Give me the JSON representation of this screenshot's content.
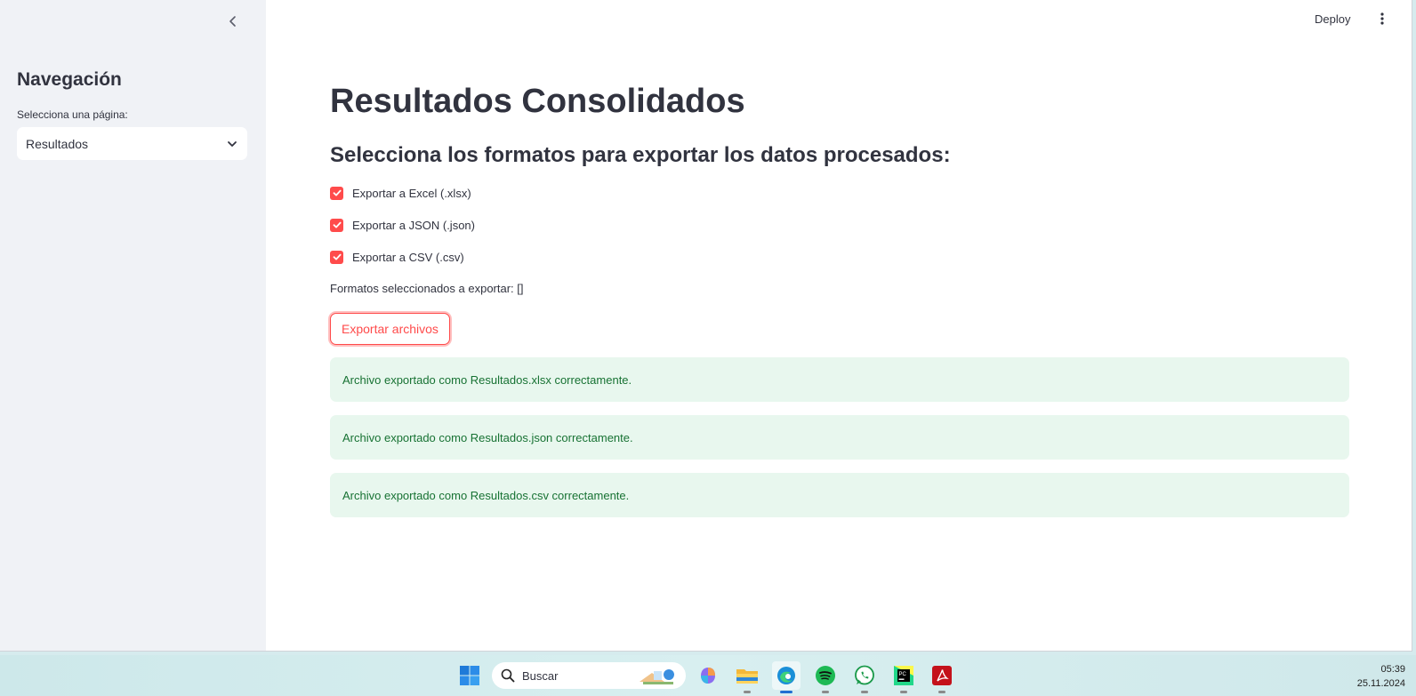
{
  "sidebar": {
    "title": "Navegación",
    "select_label": "Selecciona una página:",
    "select_value": "Resultados"
  },
  "topbar": {
    "deploy_label": "Deploy"
  },
  "main": {
    "title": "Resultados Consolidados",
    "subheader": "Selecciona los formatos para exportar los datos procesados:",
    "checkboxes": [
      {
        "label": "Exportar a Excel (.xlsx)",
        "checked": true
      },
      {
        "label": "Exportar a JSON (.json)",
        "checked": true
      },
      {
        "label": "Exportar a CSV (.csv)",
        "checked": true
      }
    ],
    "selected_formats_text": "Formatos seleccionados a exportar: []",
    "export_button_label": "Exportar archivos",
    "alerts": [
      "Archivo exportado como Resultados.xlsx correctamente.",
      "Archivo exportado como Resultados.json correctamente.",
      "Archivo exportado como Resultados.csv correctamente."
    ]
  },
  "colors": {
    "accent": "#ff4b4b",
    "success_bg": "#e8f7ee",
    "success_text": "#177233",
    "sidebar_bg": "#f0f2f6"
  },
  "taskbar": {
    "search_placeholder": "Buscar",
    "time": "05:39",
    "date": "25.11.2024",
    "icons": [
      "windows-start-icon",
      "copilot-icon",
      "file-explorer-icon",
      "edge-icon",
      "spotify-icon",
      "whatsapp-icon",
      "pycharm-icon",
      "acrobat-icon"
    ]
  }
}
